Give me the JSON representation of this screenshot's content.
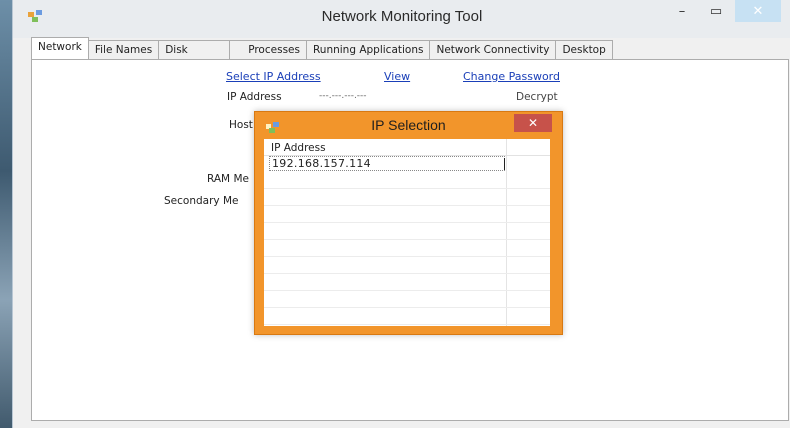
{
  "window": {
    "title": "Network Monitoring Tool",
    "controls": {
      "minimize": "–",
      "maximize": "▭",
      "close": "✕"
    }
  },
  "tabs": [
    {
      "label": "Network",
      "active": true
    },
    {
      "label": "File Names"
    },
    {
      "label": "Disk"
    },
    {
      "label": "Processes"
    },
    {
      "label": "Running Applications"
    },
    {
      "label": "Network Connectivity"
    },
    {
      "label": "Desktop"
    }
  ],
  "network": {
    "links": {
      "select_ip": "Select IP Address",
      "view": "View",
      "change_password": "Change Password"
    },
    "ip_label": "IP Address",
    "ip_value": "---.---.---.---",
    "decrypt": "Decrypt",
    "host_label_partial": "Host N",
    "ho_label_partial": "Ho",
    "ram_label_partial": "RAM Me",
    "secondary_label_partial": "Secondary Me"
  },
  "dialog": {
    "title": "IP Selection",
    "close": "✕",
    "column_header": "IP Address",
    "rows": [
      "192.168.157.114"
    ]
  },
  "colors": {
    "dialog_border": "#f2952b",
    "link": "#1a3fb8",
    "close_button": "#c7524a"
  }
}
